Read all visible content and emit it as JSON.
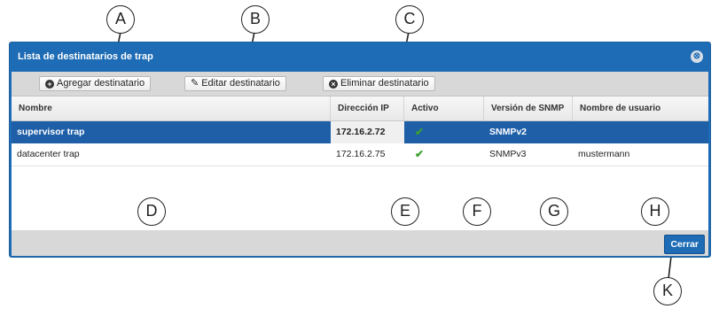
{
  "dialog": {
    "title": "Lista de destinatarios de trap",
    "close_glyph": "⊗"
  },
  "toolbar": {
    "add_label": "Agregar destinatario",
    "edit_label": "Editar destinatario",
    "delete_label": "Eliminar destinatario"
  },
  "table": {
    "columns": [
      "Nombre",
      "Dirección IP",
      "Activo",
      "Versión de SNMP",
      "Nombre de usuario"
    ],
    "rows": [
      {
        "name": "supervisor trap",
        "ip": "172.16.2.72",
        "active": true,
        "snmp": "SNMPv2",
        "user": "",
        "selected": true
      },
      {
        "name": "datacenter trap",
        "ip": "172.16.2.75",
        "active": true,
        "snmp": "SNMPv3",
        "user": "mustermann",
        "selected": false
      }
    ]
  },
  "footer": {
    "close_label": "Cerrar"
  },
  "callouts": [
    "A",
    "B",
    "C",
    "D",
    "E",
    "F",
    "G",
    "H",
    "K"
  ],
  "colors": {
    "accent": "#1e6cb5",
    "selected_row": "#1e5fa8",
    "check": "#3aa02e"
  }
}
